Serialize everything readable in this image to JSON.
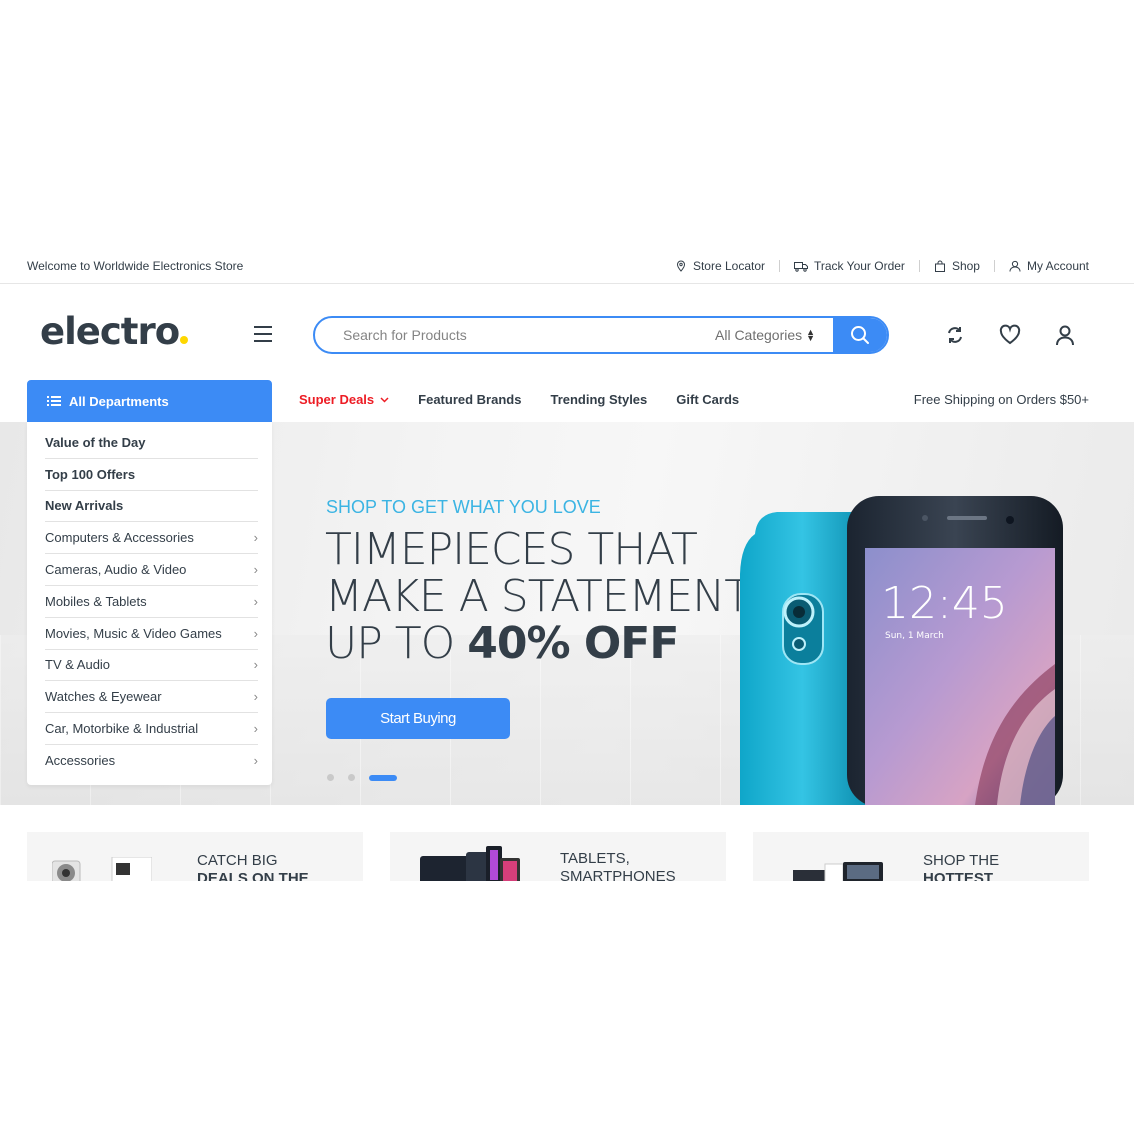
{
  "topbar": {
    "welcome": "Welcome to Worldwide Electronics Store",
    "links": [
      {
        "label": "Store Locator",
        "icon": "map-pin-icon"
      },
      {
        "label": "Track Your Order",
        "icon": "truck-icon"
      },
      {
        "label": "Shop",
        "icon": "shopping-bag-icon"
      },
      {
        "label": "My Account",
        "icon": "user-icon"
      }
    ]
  },
  "header": {
    "logo_text": "electro",
    "logo_dot_color": "#fed700",
    "search": {
      "placeholder": "Search for Products",
      "category": "All Categories"
    }
  },
  "nav": {
    "departments_label": "All Departments",
    "items": [
      "Super Deals",
      "Featured Brands",
      "Trending Styles",
      "Gift Cards"
    ],
    "free_shipping": "Free Shipping on Orders $50+"
  },
  "sidebar": {
    "items": [
      "Value of the Day",
      "Top 100 Offers",
      "New Arrivals",
      "Computers & Accessories",
      "Cameras, Audio & Video",
      "Mobiles & Tablets",
      "Movies, Music & Video Games",
      "TV & Audio",
      "Watches & Eyewear",
      "Car, Motorbike & Industrial",
      "Accessories"
    ]
  },
  "hero": {
    "eyebrow": "SHOP TO GET WHAT YOU LOVE",
    "line1": "TIMEPIECES THAT",
    "line2": "MAKE A STATEMENT",
    "line3_prefix": "UP TO ",
    "line3_bold": "40% OFF",
    "cta": "Start Buying",
    "phone_time": "12:45",
    "phone_date": "Sun, 1 March",
    "slides": 3,
    "active_slide": 3
  },
  "promos": [
    {
      "line1": "CATCH BIG",
      "line2": "DEALS ON THE"
    },
    {
      "line1": "TABLETS,",
      "line2": "SMARTPHONES"
    },
    {
      "line1": "SHOP THE",
      "line2": "HOTTEST"
    }
  ],
  "colors": {
    "accent": "#3c8bf5",
    "text": "#333e48",
    "deal_red": "#ed1c24",
    "eyebrow_blue": "#3bb4e3"
  }
}
